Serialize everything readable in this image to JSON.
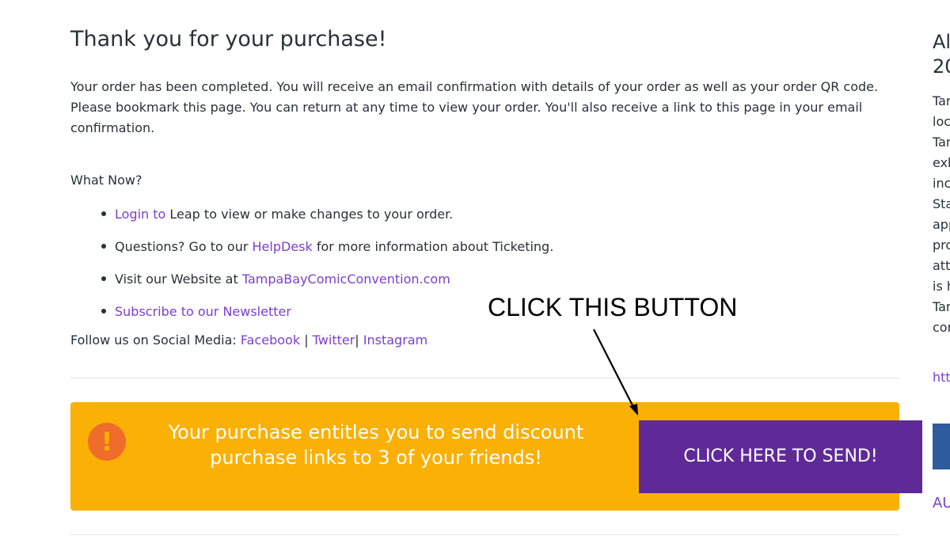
{
  "main": {
    "title": "Thank you for your purchase!",
    "paragraph": "Your order has been completed. You will receive an email confirmation with details of your order as well as your order QR code. Please bookmark this page. You can return at any time to view your order. You'll also receive a link to this page in your email confirmation.",
    "what_now": "What Now?",
    "steps": [
      {
        "link": "Login to",
        "text": " Leap to view or make changes to your order."
      },
      {
        "prefix": "Questions? Go to our ",
        "link": "HelpDesk",
        "suffix": " for more information about Ticketing."
      },
      {
        "prefix": "Visit our Website at ",
        "link": "TampaBayComicConvention.com"
      },
      {
        "link": "Subscribe to our Newsletter"
      }
    ],
    "social": {
      "label": "Follow us on Social Media: ",
      "facebook": "Facebook",
      "twitter": "Twitter",
      "instagram": "Instagram",
      "sep1": "|",
      "sep2": "|"
    }
  },
  "alert": {
    "icon": "exclamation-icon",
    "text": "Your purchase entitles you to send discount purchase links to 3 of your friends!",
    "button": "CLICK HERE TO SEND!",
    "bg_color": "#fbb005",
    "button_color": "#5f2a98"
  },
  "annotation": {
    "label": "CLICK THIS BUTTON"
  },
  "sidebar": {
    "title_fragment": "Al\n20",
    "text_fragment": "Tar\nloc\nTar\nexh\ninc\nSta\napp\npro\natt\nis h\nTar\ncon",
    "link_fragment": "htt",
    "link2_fragment": "AU"
  },
  "colors": {
    "link": "#7b3fd0",
    "text": "#2b2f36"
  }
}
